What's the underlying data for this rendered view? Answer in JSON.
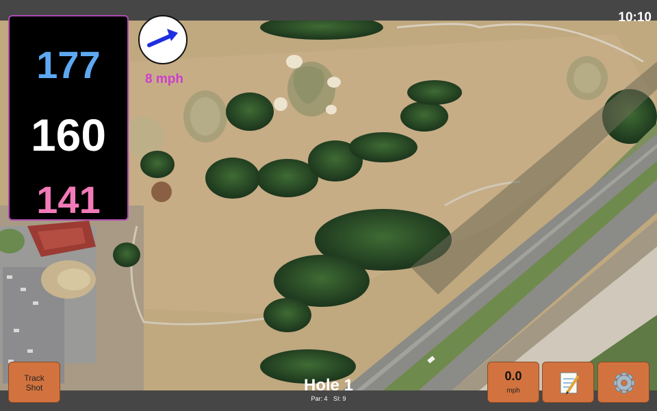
{
  "status_bar": {
    "time": "10:10"
  },
  "distances": {
    "back": "177",
    "middle": "160",
    "front": "141"
  },
  "wind": {
    "speed": "8 mph",
    "icon": "wind-arrow-icon",
    "direction": "east-northeast"
  },
  "buttons": {
    "track_shot": "Track\nShot",
    "speed_value": "0.0",
    "speed_unit": "mph",
    "notes_icon": "notepad-icon",
    "settings_icon": "gear-icon"
  },
  "hole": {
    "title": "Hole 1",
    "par": "Par: 4",
    "si": "SI: 9"
  },
  "colors": {
    "back": "#5ea8f2",
    "middle": "#ffffff",
    "front": "#f27ab8",
    "wind_text": "#cc3fcc",
    "button": "#d2733f",
    "panel_border": "#b04bb0"
  }
}
